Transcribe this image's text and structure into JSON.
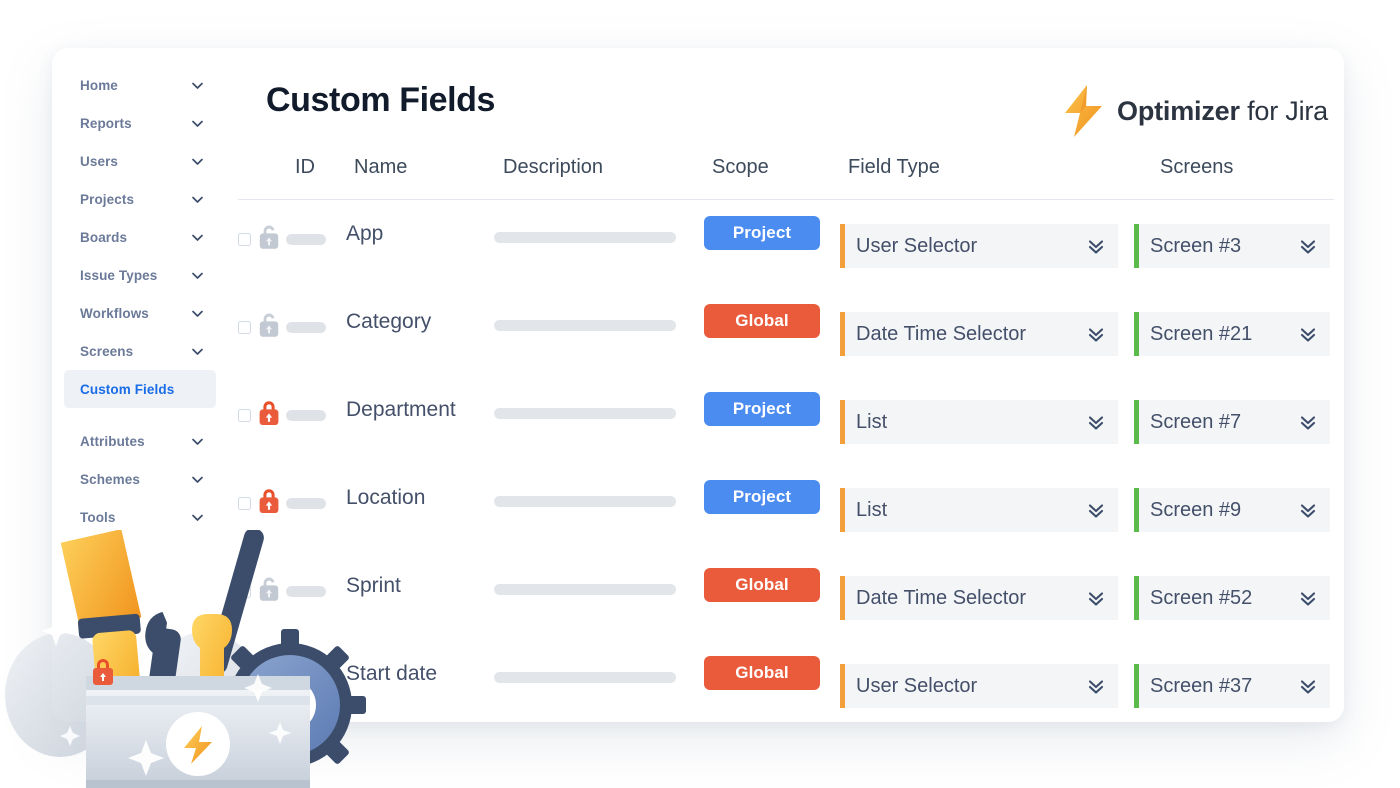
{
  "brand": {
    "name": "Optimizer",
    "suffix": "for Jira",
    "logo_icon": "lightning-bolt-icon",
    "logo_color": "#f5a623"
  },
  "page": {
    "title": "Custom Fields"
  },
  "sidebar": {
    "items": [
      {
        "label": "Home",
        "icon": "chevron-down-icon",
        "active": false
      },
      {
        "label": "Reports",
        "icon": "chevron-down-icon",
        "active": false
      },
      {
        "label": "Users",
        "icon": "chevron-down-icon",
        "active": false
      },
      {
        "label": "Projects",
        "icon": "chevron-down-icon",
        "active": false
      },
      {
        "label": "Boards",
        "icon": "chevron-down-icon",
        "active": false
      },
      {
        "label": "Issue Types",
        "icon": "chevron-down-icon",
        "active": false
      },
      {
        "label": "Workflows",
        "icon": "chevron-down-icon",
        "active": false
      },
      {
        "label": "Screens",
        "icon": "chevron-down-icon",
        "active": false
      },
      {
        "label": "Custom Fields",
        "icon": null,
        "active": true
      },
      {
        "label": "Attributes",
        "icon": "chevron-down-icon",
        "active": false
      },
      {
        "label": "Schemes",
        "icon": "chevron-down-icon",
        "active": false
      },
      {
        "label": "Tools",
        "icon": "chevron-down-icon",
        "active": false
      }
    ],
    "active_color": "#1a6ce8",
    "label_color": "#6b7a99"
  },
  "table": {
    "columns": [
      "ID",
      "Name",
      "Description",
      "Scope",
      "Field Type",
      "Screens"
    ],
    "scope_colors": {
      "Project": "#4a8cf0",
      "Global": "#ea5b3b"
    },
    "accent_field_type": "#f3a03c",
    "accent_screens": "#5aba4a",
    "rows": [
      {
        "lock": "unlocked-grey",
        "name": "App",
        "scope": "Project",
        "field_type": "User Selector",
        "screen": "Screen #3"
      },
      {
        "lock": "unlocked-grey",
        "name": "Category",
        "scope": "Global",
        "field_type": "Date Time Selector",
        "screen": "Screen #21"
      },
      {
        "lock": "locked-red",
        "name": "Department",
        "scope": "Project",
        "field_type": "List",
        "screen": "Screen #7"
      },
      {
        "lock": "locked-red",
        "name": "Location",
        "scope": "Project",
        "field_type": "List",
        "screen": "Screen #9"
      },
      {
        "lock": "unlocked-grey",
        "name": "Sprint",
        "scope": "Global",
        "field_type": "Date Time Selector",
        "screen": "Screen #52"
      },
      {
        "lock": "locked-red",
        "name": "Start date",
        "scope": "Global",
        "field_type": "User Selector",
        "screen": "Screen #37"
      }
    ]
  },
  "illustration": {
    "name": "toolbox-with-gear-illustration"
  }
}
